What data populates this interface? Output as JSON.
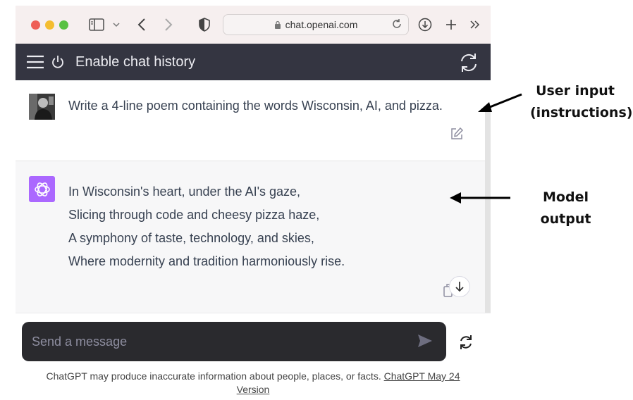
{
  "browser": {
    "url": "chat.openai.com",
    "icons": [
      "sidebar-icon",
      "chevron-down-icon",
      "back-icon",
      "forward-icon",
      "shield-icon",
      "lock-icon",
      "reload-icon",
      "download-icon",
      "new-tab-icon",
      "more-icon"
    ]
  },
  "header": {
    "title": "Enable chat history",
    "background": "#343541"
  },
  "conversation": {
    "user_message": "Write a 4-line poem containing the words Wisconsin, AI, and pizza.",
    "model_lines": [
      "In Wisconsin's heart, under the AI's gaze,",
      "Slicing through code and cheesy pizza haze,",
      "A symphony of taste, technology, and skies,",
      "Where modernity and tradition harmoniously rise."
    ],
    "bot_avatar_color": "#ab68ff"
  },
  "composer": {
    "placeholder": "Send a message"
  },
  "footer": {
    "disclaimer": "ChatGPT may produce inaccurate information about people, places, or facts.",
    "version_link": "ChatGPT May 24 Version"
  },
  "annotations": {
    "user_input_line1": "User input",
    "user_input_line2": "(instructions)",
    "model_output": "Model output"
  }
}
